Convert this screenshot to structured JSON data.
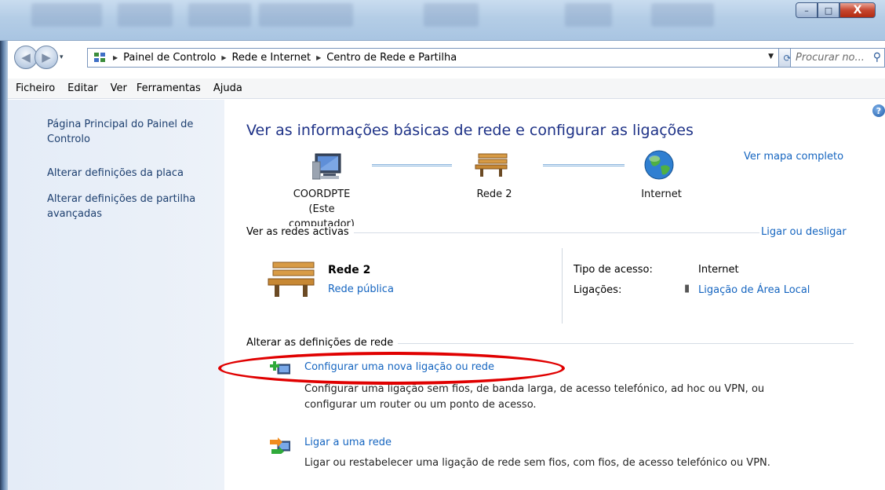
{
  "window": {
    "minimize_label": "–",
    "maximize_label": "□",
    "close_label": "X"
  },
  "address": {
    "breadcrumbs": [
      "Painel de Controlo",
      "Rede e Internet",
      "Centro de Rede e Partilha"
    ],
    "search_placeholder": "Procurar no..."
  },
  "menu": [
    "Ficheiro",
    "Editar",
    "Ver",
    "Ferramentas",
    "Ajuda"
  ],
  "sidebar": {
    "items": [
      {
        "label": "Página Principal do Painel de Controlo"
      },
      {
        "label": "Alterar definições da placa"
      },
      {
        "label": "Alterar definições de partilha avançadas"
      }
    ]
  },
  "main": {
    "help_label": "?",
    "heading": "Ver as informações básicas de rede e configurar as ligações",
    "full_map_link": "Ver mapa completo",
    "map": {
      "computer_name": "COORDPTE",
      "computer_sub": "(Este computador)",
      "network_name": "Rede 2",
      "internet_name": "Internet"
    },
    "active_networks_label": "Ver as redes activas",
    "connect_disconnect_link": "Ligar ou desligar",
    "active_network": {
      "name": "Rede 2",
      "type_link": "Rede pública",
      "access_type_label": "Tipo de acesso:",
      "access_type_value": "Internet",
      "connections_label": "Ligações:",
      "connections_value": "Ligação de Área Local"
    },
    "change_settings_label": "Alterar as definições de rede",
    "tasks": [
      {
        "title": "Configurar uma nova ligação ou rede",
        "desc_line1": "Configurar uma ligação sem fios, de banda larga, de acesso telefónico, ad hoc ou VPN, ou",
        "desc_line2": "configurar um router ou um ponto de acesso."
      },
      {
        "title": "Ligar a uma rede",
        "desc_line1": "Ligar ou restabelecer uma ligação de rede sem fios, com fios, de acesso telefónico ou VPN."
      }
    ]
  },
  "colors": {
    "link": "#1565c0",
    "heading": "#1e3287",
    "highlight": "#e00000"
  }
}
